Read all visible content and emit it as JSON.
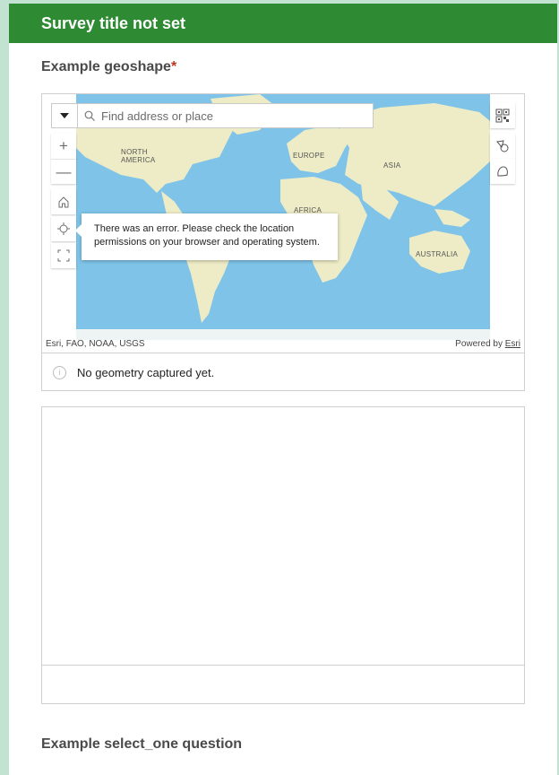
{
  "header": {
    "title": "Survey title not set"
  },
  "question1": {
    "label": "Example geoshape",
    "required_mark": "*"
  },
  "map": {
    "search_placeholder": "Find address or place",
    "zoom_in": "+",
    "zoom_out": "—",
    "labels": {
      "north_america": "NORTH\nAMERICA",
      "europe": "EUROPE",
      "asia": "ASIA",
      "africa": "AFRICA",
      "australia": "AUSTRALIA"
    },
    "error_popup": "There was an error. Please check the location permissions on your browser and operating system.",
    "attribution": "Esri, FAO, NOAA, USGS",
    "powered_by": "Powered by",
    "powered_by_link": "Esri",
    "status": "No geometry captured yet."
  },
  "question2": {
    "label": "Example select_one question"
  },
  "colors": {
    "header_bg": "#2f8a34",
    "page_bg": "#c2e3d2",
    "ocean": "#7fc4e8",
    "land": "#eeecc6",
    "required": "#c2331a"
  }
}
